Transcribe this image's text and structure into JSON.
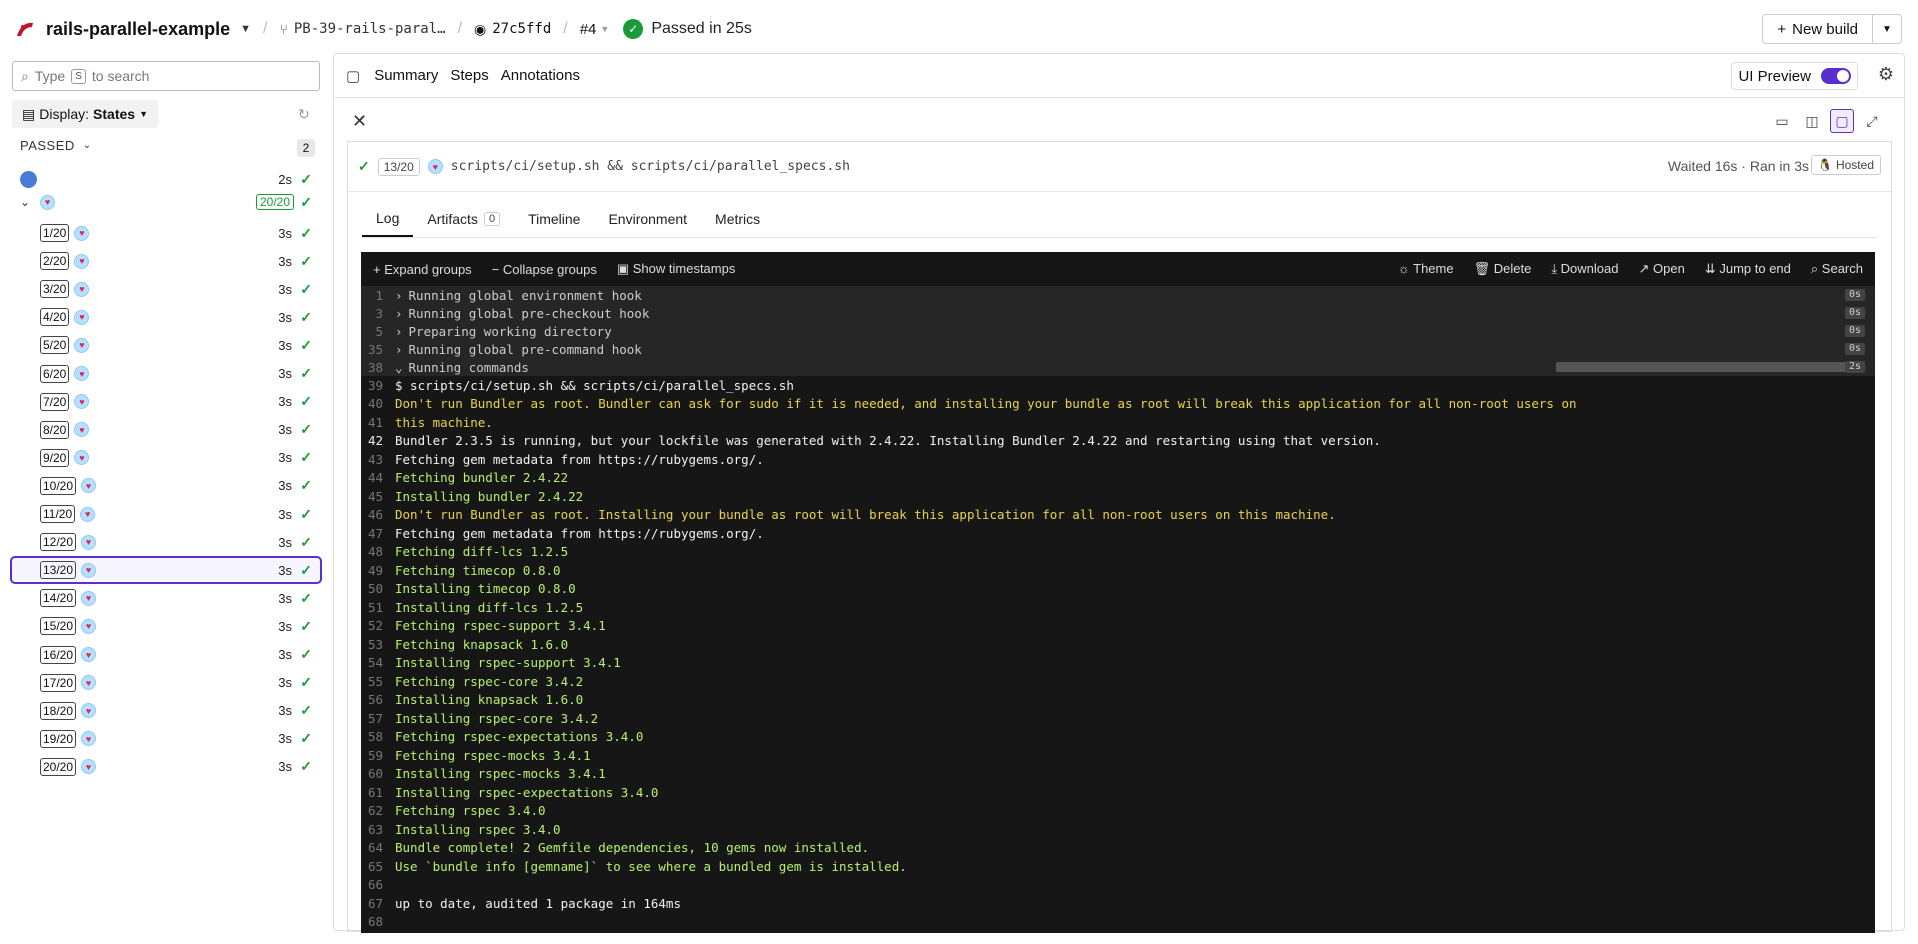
{
  "topbar": {
    "pipeline": "rails-parallel-example",
    "branch": "PB-39-rails-paral…",
    "commit": "27c5ffd",
    "build": "#4",
    "status": "Passed in 25s",
    "new_build": "New build"
  },
  "sidebar": {
    "search_placeholder": "Type",
    "search_key": "S",
    "search_suffix": "to search",
    "display_label": "Display:",
    "display_value": "States",
    "passed_label": "PASSED",
    "passed_count": "2",
    "first_job_duration": "2s",
    "group_count": "20/20",
    "jobs": [
      {
        "label": "1/20",
        "duration": "3s"
      },
      {
        "label": "2/20",
        "duration": "3s"
      },
      {
        "label": "3/20",
        "duration": "3s"
      },
      {
        "label": "4/20",
        "duration": "3s"
      },
      {
        "label": "5/20",
        "duration": "3s"
      },
      {
        "label": "6/20",
        "duration": "3s"
      },
      {
        "label": "7/20",
        "duration": "3s"
      },
      {
        "label": "8/20",
        "duration": "3s"
      },
      {
        "label": "9/20",
        "duration": "3s"
      },
      {
        "label": "10/20",
        "duration": "3s"
      },
      {
        "label": "11/20",
        "duration": "3s"
      },
      {
        "label": "12/20",
        "duration": "3s"
      },
      {
        "label": "13/20",
        "duration": "3s"
      },
      {
        "label": "14/20",
        "duration": "3s"
      },
      {
        "label": "15/20",
        "duration": "3s"
      },
      {
        "label": "16/20",
        "duration": "3s"
      },
      {
        "label": "17/20",
        "duration": "3s"
      },
      {
        "label": "18/20",
        "duration": "3s"
      },
      {
        "label": "19/20",
        "duration": "3s"
      },
      {
        "label": "20/20",
        "duration": "3s"
      }
    ],
    "selected_job": "13/20"
  },
  "panel": {
    "tabs": [
      "Summary",
      "Steps",
      "Annotations"
    ],
    "ui_preview": "UI Preview",
    "job_chip": "13/20",
    "job_command": "scripts/ci/setup.sh && scripts/ci/parallel_specs.sh",
    "job_meta": "Waited 16s · Ran in 3s",
    "hosted": "Hosted",
    "subtabs": [
      "Log",
      "Artifacts",
      "Timeline",
      "Environment",
      "Metrics"
    ],
    "artifacts_count": "0"
  },
  "log": {
    "toolbar_left": [
      "Expand groups",
      "Collapse groups",
      "Show timestamps"
    ],
    "toolbar_right": [
      "Theme",
      "Delete",
      "Download",
      "Open",
      "Jump to end",
      "Search"
    ],
    "groups": [
      {
        "n": "1",
        "text": "Running global environment hook",
        "dur": "0s"
      },
      {
        "n": "3",
        "text": "Running global pre-checkout hook",
        "dur": "0s"
      },
      {
        "n": "5",
        "text": "Preparing working directory",
        "dur": "0s"
      },
      {
        "n": "35",
        "text": "Running global pre-command hook",
        "dur": "0s"
      },
      {
        "n": "38",
        "text": "Running commands",
        "dur": "2s"
      }
    ],
    "lines": [
      {
        "n": "39",
        "text": "$ scripts/ci/setup.sh && scripts/ci/parallel_specs.sh",
        "c": "w"
      },
      {
        "n": "40",
        "text": "Don't run Bundler as root. Bundler can ask for sudo if it is needed, and installing your bundle as root will break this application for all non-root users on",
        "c": "y"
      },
      {
        "n": "41",
        "text": "this machine.",
        "c": "y"
      },
      {
        "n": "42",
        "text": "Bundler 2.3.5 is running, but your lockfile was generated with 2.4.22. Installing Bundler 2.4.22 and restarting using that version.",
        "c": "w",
        "hl": true
      },
      {
        "n": "43",
        "text": "Fetching gem metadata from https://rubygems.org/.",
        "c": "w"
      },
      {
        "n": "44",
        "text": "Fetching bundler 2.4.22",
        "c": "g"
      },
      {
        "n": "45",
        "text": "Installing bundler 2.4.22",
        "c": "g"
      },
      {
        "n": "46",
        "text": "Don't run Bundler as root. Installing your bundle as root will break this application for all non-root users on this machine.",
        "c": "y"
      },
      {
        "n": "47",
        "text": "Fetching gem metadata from https://rubygems.org/.",
        "c": "w"
      },
      {
        "n": "48",
        "text": "Fetching diff-lcs 1.2.5",
        "c": "g"
      },
      {
        "n": "49",
        "text": "Fetching timecop 0.8.0",
        "c": "g"
      },
      {
        "n": "50",
        "text": "Installing timecop 0.8.0",
        "c": "g"
      },
      {
        "n": "51",
        "text": "Installing diff-lcs 1.2.5",
        "c": "g"
      },
      {
        "n": "52",
        "text": "Fetching rspec-support 3.4.1",
        "c": "g"
      },
      {
        "n": "53",
        "text": "Fetching knapsack 1.6.0",
        "c": "g"
      },
      {
        "n": "54",
        "text": "Installing rspec-support 3.4.1",
        "c": "g"
      },
      {
        "n": "55",
        "text": "Fetching rspec-core 3.4.2",
        "c": "g"
      },
      {
        "n": "56",
        "text": "Installing knapsack 1.6.0",
        "c": "g"
      },
      {
        "n": "57",
        "text": "Installing rspec-core 3.4.2",
        "c": "g"
      },
      {
        "n": "58",
        "text": "Fetching rspec-expectations 3.4.0",
        "c": "g"
      },
      {
        "n": "59",
        "text": "Fetching rspec-mocks 3.4.1",
        "c": "g"
      },
      {
        "n": "60",
        "text": "Installing rspec-mocks 3.4.1",
        "c": "g"
      },
      {
        "n": "61",
        "text": "Installing rspec-expectations 3.4.0",
        "c": "g"
      },
      {
        "n": "62",
        "text": "Fetching rspec 3.4.0",
        "c": "g"
      },
      {
        "n": "63",
        "text": "Installing rspec 3.4.0",
        "c": "g"
      },
      {
        "n": "64",
        "text": "Bundle complete! 2 Gemfile dependencies, 10 gems now installed.",
        "c": "g"
      },
      {
        "n": "65",
        "text": "Use `bundle info [gemname]` to see where a bundled gem is installed.",
        "c": "g"
      },
      {
        "n": "66",
        "text": "",
        "c": "w"
      },
      {
        "n": "67",
        "text": "up to date, audited 1 package in 164ms",
        "c": "w"
      },
      {
        "n": "68",
        "text": "",
        "c": "w"
      }
    ]
  }
}
